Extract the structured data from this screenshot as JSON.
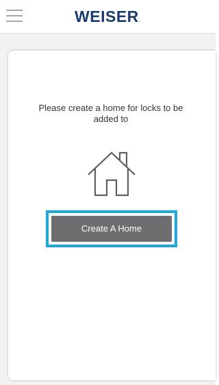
{
  "header": {
    "menu_icon": "hamburger-menu-icon",
    "logo_text": "WEISER",
    "logo_mark": "."
  },
  "main": {
    "message": "Please create a home for locks to be added to",
    "illustration_icon": "house-icon",
    "create_button_label": "Create A Home"
  },
  "colors": {
    "brand": "#1d3b6b",
    "highlight": "#1aa9e0",
    "button_bg": "#6f6d6f",
    "background": "#f2f2f2"
  }
}
